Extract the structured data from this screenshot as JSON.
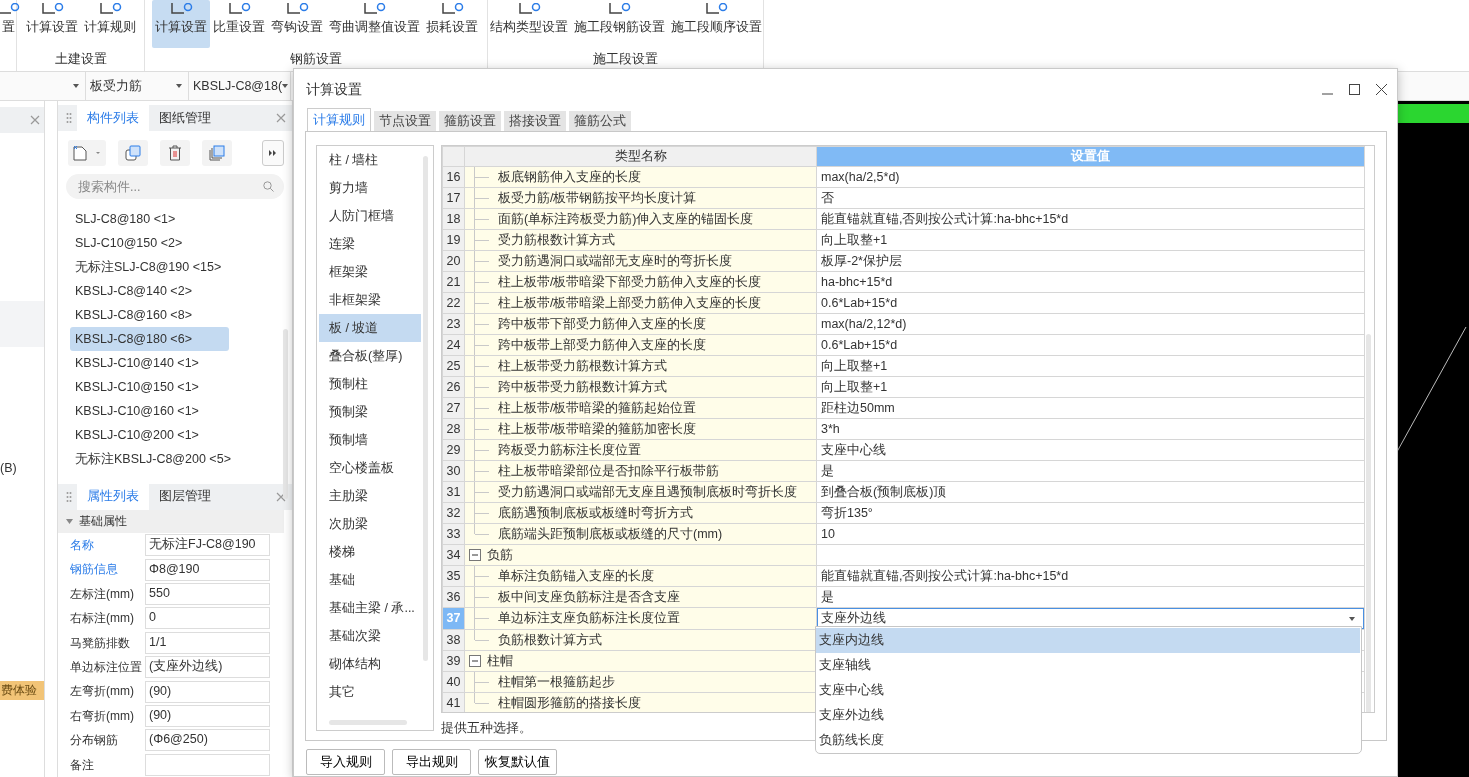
{
  "ribbon": {
    "groups": [
      {
        "items": [
          {
            "label": "置",
            "selected": false
          }
        ]
      },
      {
        "label": "土建设置",
        "items": [
          {
            "label": "计算设置",
            "selected": false
          },
          {
            "label": "计算规则",
            "selected": false
          }
        ]
      },
      {
        "label": "钢筋设置",
        "items": [
          {
            "label": "计算设置",
            "selected": true
          },
          {
            "label": "比重设置",
            "selected": false
          },
          {
            "label": "弯钩设置",
            "selected": false
          },
          {
            "label": "弯曲调整值设置",
            "selected": false
          },
          {
            "label": "损耗设置",
            "selected": false
          }
        ]
      },
      {
        "label": "施工段设置",
        "items": [
          {
            "label": "结构类型设置",
            "selected": false
          },
          {
            "label": "施工段钢筋设置",
            "selected": false
          },
          {
            "label": "施工段顺序设置",
            "selected": false
          }
        ]
      }
    ]
  },
  "selectors": [
    {
      "value": "板受力筋"
    },
    {
      "value": "KBSLJ-C8@18("
    }
  ],
  "side_panel": {
    "marker": "(B)",
    "badge": "费体验"
  },
  "component_panel": {
    "tabs": [
      {
        "label": "构件列表",
        "selected": true
      },
      {
        "label": "图纸管理",
        "selected": false
      }
    ],
    "search": {
      "placeholder": "搜索构件..."
    },
    "items": [
      {
        "label": "SLJ-C8@180 <1>",
        "selected": false
      },
      {
        "label": "SLJ-C10@150 <2>",
        "selected": false
      },
      {
        "label": "无标注SLJ-C8@190 <15>",
        "selected": false
      },
      {
        "label": "KBSLJ-C8@140 <2>",
        "selected": false
      },
      {
        "label": "KBSLJ-C8@160 <8>",
        "selected": false
      },
      {
        "label": "KBSLJ-C8@180 <6>",
        "selected": true
      },
      {
        "label": "KBSLJ-C10@140 <1>",
        "selected": false
      },
      {
        "label": "KBSLJ-C10@150 <1>",
        "selected": false
      },
      {
        "label": "KBSLJ-C10@160 <1>",
        "selected": false
      },
      {
        "label": "KBSLJ-C10@200 <1>",
        "selected": false
      },
      {
        "label": "无标注KBSLJ-C8@200 <5>",
        "selected": false
      }
    ]
  },
  "property_panel": {
    "tabs": [
      {
        "label": "属性列表",
        "selected": true
      },
      {
        "label": "图层管理",
        "selected": false
      }
    ],
    "group": {
      "label": "基础属性",
      "expanded": true
    },
    "rows": [
      {
        "label": "名称",
        "value": "无标注FJ-C8@190",
        "emphasized": true
      },
      {
        "label": "钢筋信息",
        "value": "Φ8@190",
        "emphasized": true
      },
      {
        "label": "左标注(mm)",
        "value": "550",
        "emphasized": false
      },
      {
        "label": "右标注(mm)",
        "value": "0",
        "emphasized": false
      },
      {
        "label": "马凳筋排数",
        "value": "1/1",
        "emphasized": false
      },
      {
        "label": "单边标注位置",
        "value": "(支座外边线)",
        "emphasized": false
      },
      {
        "label": "左弯折(mm)",
        "value": "(90)",
        "emphasized": false
      },
      {
        "label": "右弯折(mm)",
        "value": "(90)",
        "emphasized": false
      },
      {
        "label": "分布钢筋",
        "value": "(Φ6@250)",
        "emphasized": false
      },
      {
        "label": "备注",
        "emphasized": false
      }
    ]
  },
  "dialog": {
    "title": "计算设置",
    "tabs": [
      {
        "label": "计算规则",
        "selected": true
      },
      {
        "label": "节点设置",
        "selected": false
      },
      {
        "label": "箍筋设置",
        "selected": false
      },
      {
        "label": "搭接设置",
        "selected": false
      },
      {
        "label": "箍筋公式",
        "selected": false
      }
    ],
    "categories": [
      {
        "label": "柱 / 墙柱",
        "selected": false
      },
      {
        "label": "剪力墙",
        "selected": false
      },
      {
        "label": "人防门框墙",
        "selected": false
      },
      {
        "label": "连梁",
        "selected": false
      },
      {
        "label": "框架梁",
        "selected": false
      },
      {
        "label": "非框架梁",
        "selected": false
      },
      {
        "label": "板 / 坡道",
        "selected": true
      },
      {
        "label": "叠合板(整厚)",
        "selected": false
      },
      {
        "label": "预制柱",
        "selected": false
      },
      {
        "label": "预制梁",
        "selected": false
      },
      {
        "label": "预制墙",
        "selected": false
      },
      {
        "label": "空心楼盖板",
        "selected": false
      },
      {
        "label": "主肋梁",
        "selected": false
      },
      {
        "label": "次肋梁",
        "selected": false
      },
      {
        "label": "楼梯",
        "selected": false
      },
      {
        "label": "基础",
        "selected": false
      },
      {
        "label": "基础主梁 / 承...",
        "selected": false
      },
      {
        "label": "基础次梁",
        "selected": false
      },
      {
        "label": "砌体结构",
        "selected": false
      },
      {
        "label": "其它",
        "selected": false
      }
    ],
    "table": {
      "columns": [
        "类型名称",
        "设置值"
      ],
      "rows": [
        {
          "number": "16",
          "kind": "item",
          "name": "板底钢筋伸入支座的长度",
          "value": "max(ha/2,5*d)",
          "selected": false
        },
        {
          "number": "17",
          "kind": "item",
          "name": "板受力筋/板带钢筋按平均长度计算",
          "value": "否",
          "selected": false
        },
        {
          "number": "18",
          "kind": "item",
          "name": "面筋(单标注跨板受力筋)伸入支座的锚固长度",
          "value": "能直锚就直锚,否则按公式计算:ha-bhc+15*d",
          "selected": false
        },
        {
          "number": "19",
          "kind": "item",
          "name": "受力筋根数计算方式",
          "value": "向上取整+1",
          "selected": false
        },
        {
          "number": "20",
          "kind": "item",
          "name": "受力筋遇洞口或端部无支座时的弯折长度",
          "value": "板厚-2*保护层",
          "selected": false
        },
        {
          "number": "21",
          "kind": "item",
          "name": "柱上板带/板带暗梁下部受力筋伸入支座的长度",
          "value": "ha-bhc+15*d",
          "selected": false
        },
        {
          "number": "22",
          "kind": "item",
          "name": "柱上板带/板带暗梁上部受力筋伸入支座的长度",
          "value": "0.6*Lab+15*d",
          "selected": false
        },
        {
          "number": "23",
          "kind": "item",
          "name": "跨中板带下部受力筋伸入支座的长度",
          "value": "max(ha/2,12*d)",
          "selected": false
        },
        {
          "number": "24",
          "kind": "item",
          "name": "跨中板带上部受力筋伸入支座的长度",
          "value": "0.6*Lab+15*d",
          "selected": false
        },
        {
          "number": "25",
          "kind": "item",
          "name": "柱上板带受力筋根数计算方式",
          "value": "向上取整+1",
          "selected": false
        },
        {
          "number": "26",
          "kind": "item",
          "name": "跨中板带受力筋根数计算方式",
          "value": "向上取整+1",
          "selected": false
        },
        {
          "number": "27",
          "kind": "item",
          "name": "柱上板带/板带暗梁的箍筋起始位置",
          "value": "距柱边50mm",
          "selected": false
        },
        {
          "number": "28",
          "kind": "item",
          "name": "柱上板带/板带暗梁的箍筋加密长度",
          "value": "3*h",
          "selected": false
        },
        {
          "number": "29",
          "kind": "item",
          "name": "跨板受力筋标注长度位置",
          "value": "支座中心线",
          "selected": false
        },
        {
          "number": "30",
          "kind": "item",
          "name": "柱上板带暗梁部位是否扣除平行板带筋",
          "value": "是",
          "selected": false
        },
        {
          "number": "31",
          "kind": "item",
          "name": "受力筋遇洞口或端部无支座且遇预制底板时弯折长度",
          "value": "到叠合板(预制底板)顶",
          "selected": false
        },
        {
          "number": "32",
          "kind": "item",
          "name": "底筋遇预制底板或板缝时弯折方式",
          "value": "弯折135°",
          "selected": false
        },
        {
          "number": "33",
          "kind": "item",
          "name": "底筋端头距预制底板或板缝的尺寸(mm)",
          "value": "10",
          "selected": false
        },
        {
          "number": "34",
          "kind": "group",
          "name": "负筋",
          "expanded": true,
          "selected": false
        },
        {
          "number": "35",
          "kind": "item",
          "name": "单标注负筋锚入支座的长度",
          "value": "能直锚就直锚,否则按公式计算:ha-bhc+15*d",
          "selected": false
        },
        {
          "number": "36",
          "kind": "item",
          "name": "板中间支座负筋标注是否含支座",
          "value": "是",
          "selected": false
        },
        {
          "number": "37",
          "kind": "item",
          "name": "单边标注支座负筋标注长度位置",
          "value": "支座外边线",
          "selected": true
        },
        {
          "number": "38",
          "kind": "item",
          "name": "负筋根数计算方式",
          "selected": false
        },
        {
          "number": "39",
          "kind": "group",
          "name": "柱帽",
          "expanded": true,
          "selected": false
        },
        {
          "number": "40",
          "kind": "item",
          "name": "柱帽第一根箍筋起步",
          "selected": false
        },
        {
          "number": "41",
          "kind": "item",
          "name": "柱帽圆形箍筋的搭接长度",
          "selected": false
        }
      ]
    },
    "dropdown": {
      "options": [
        {
          "label": "支座内边线",
          "selected": true
        },
        {
          "label": "支座轴线",
          "selected": false
        },
        {
          "label": "支座中心线",
          "selected": false
        },
        {
          "label": "支座外边线",
          "selected": false
        },
        {
          "label": "负筋线长度",
          "selected": false
        }
      ]
    },
    "description": "提供五种选择。",
    "buttons": [
      "导入规则",
      "导出规则",
      "恢复默认值"
    ]
  }
}
